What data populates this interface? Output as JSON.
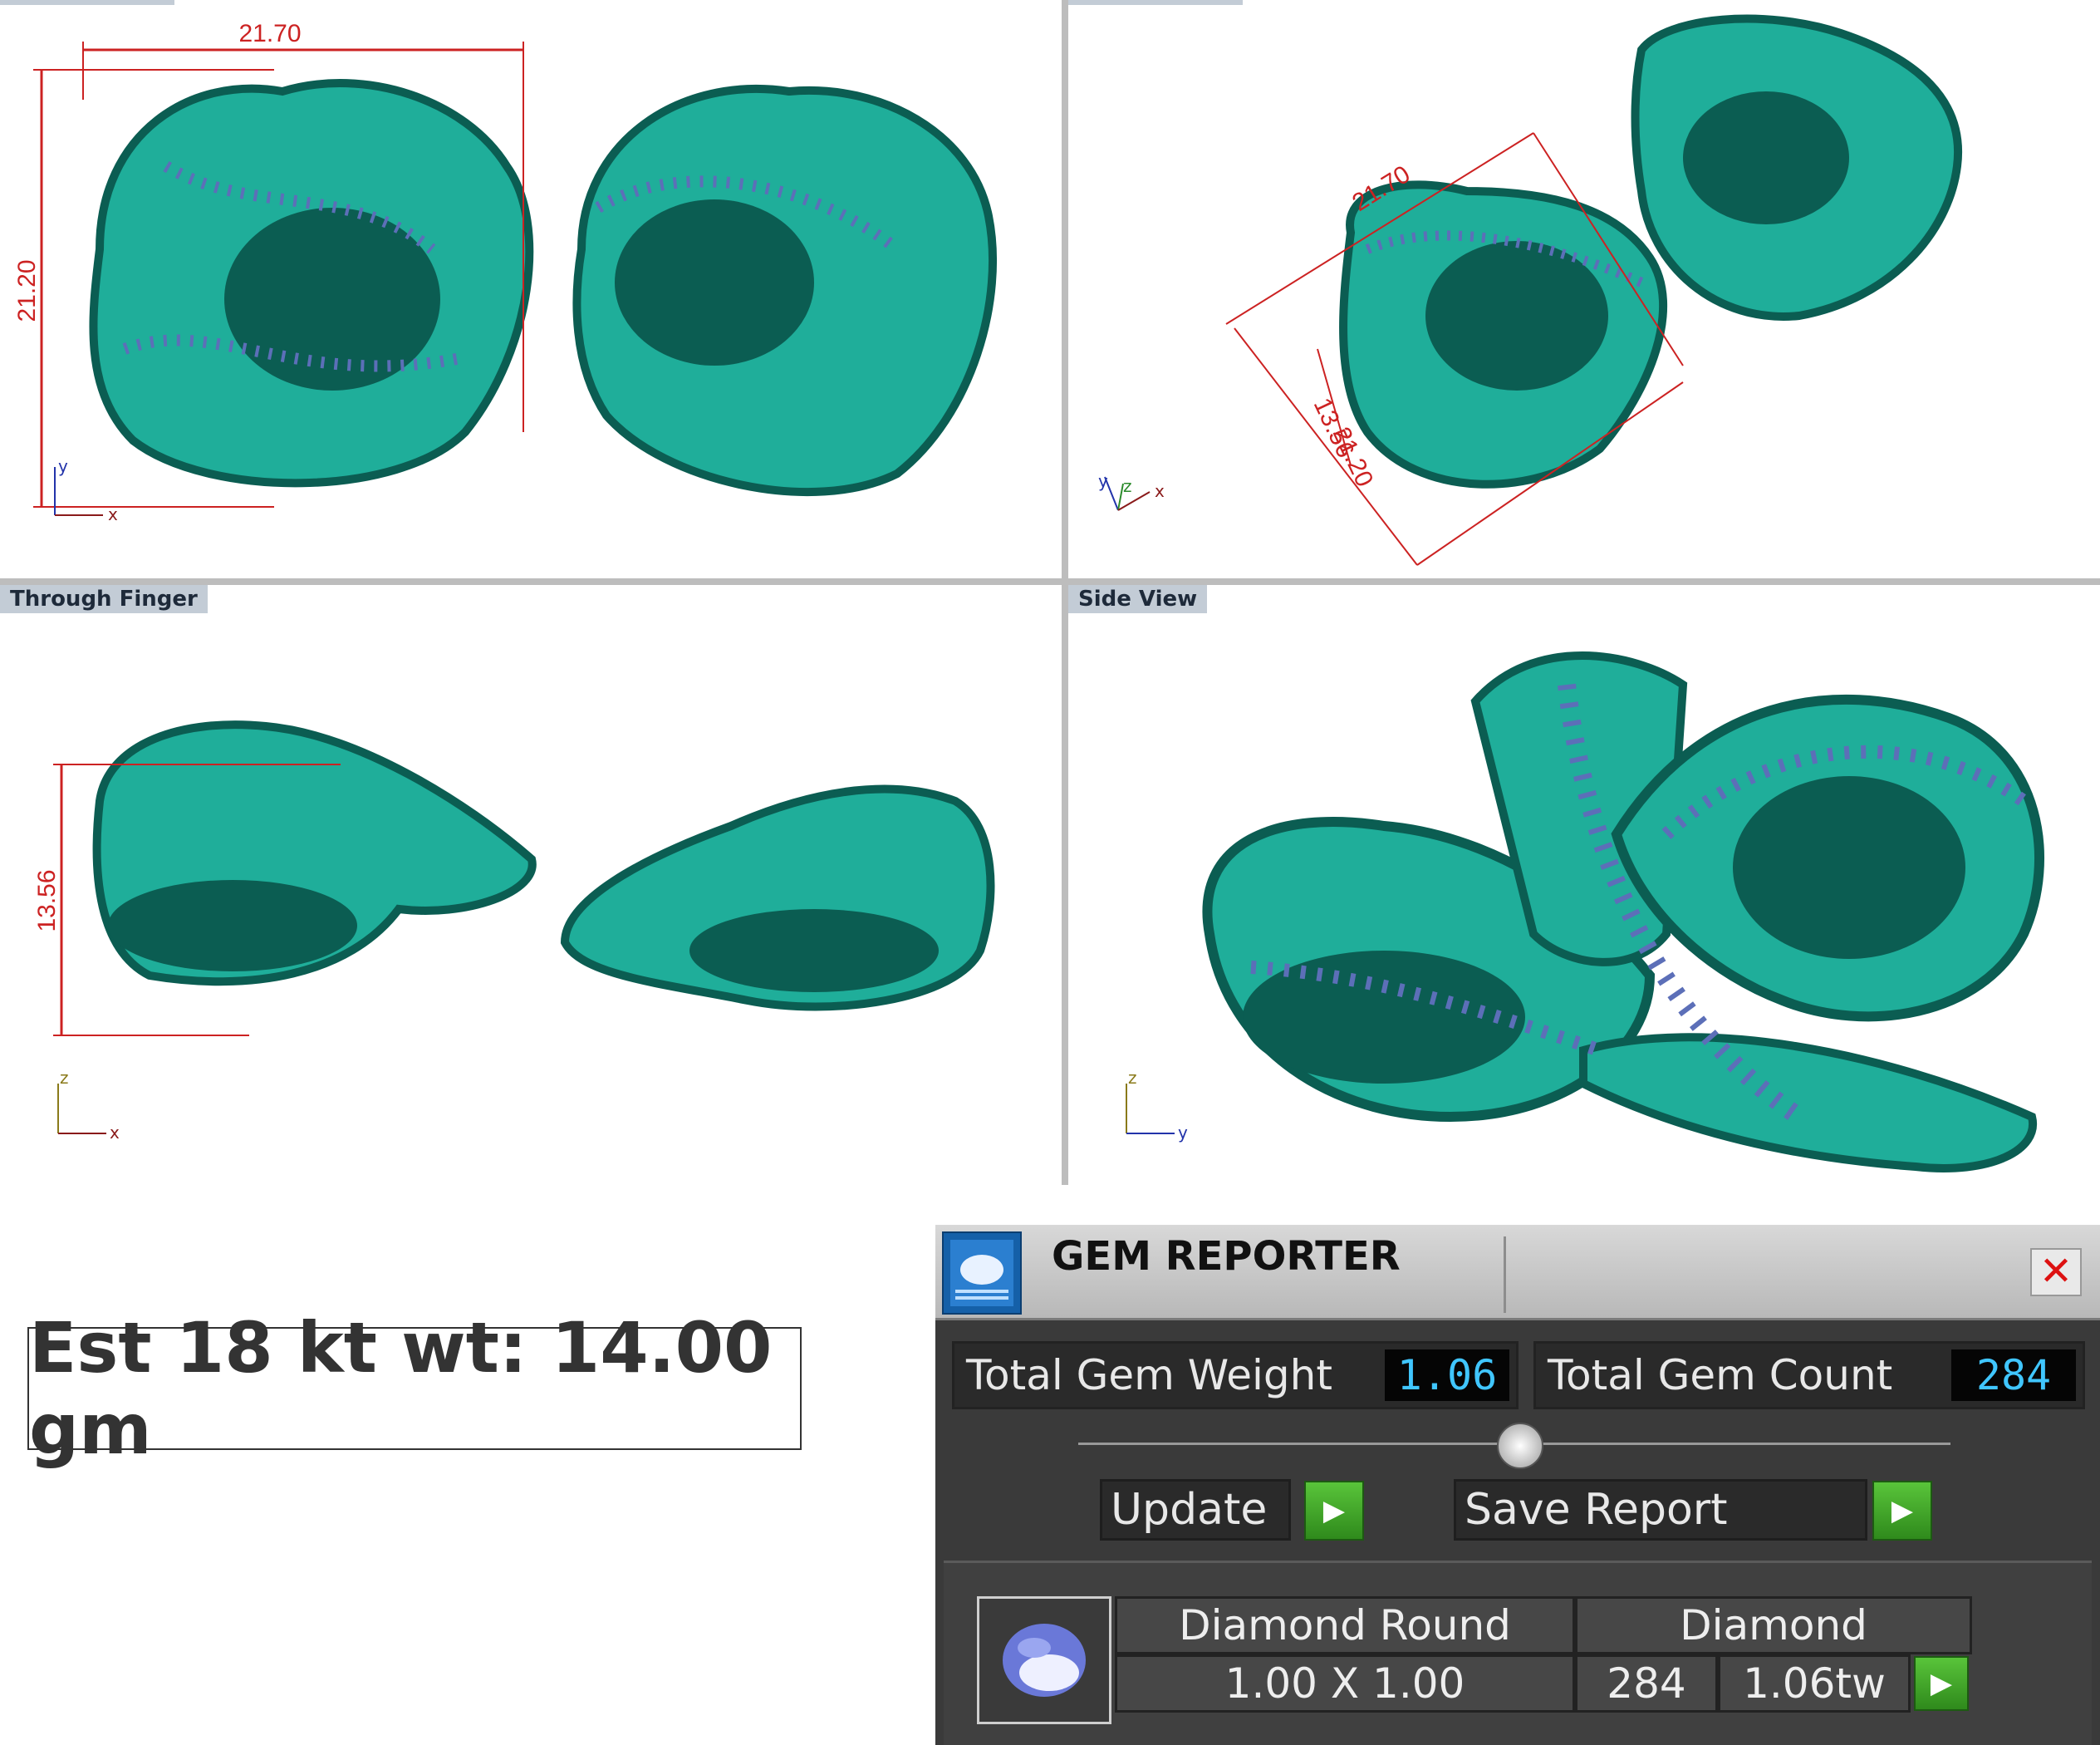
{
  "viewports": {
    "top_left": {
      "title": "",
      "dimensions": {
        "width": "21.70",
        "height": "21.20"
      },
      "axes": {
        "a": "y",
        "b": "x"
      }
    },
    "top_right": {
      "title": "",
      "dimensions": {
        "diag_1": "21.70",
        "diag_2": "13.56",
        "diag_3": "21.20"
      },
      "axes": {
        "a": "y",
        "b": "z",
        "c": "x"
      }
    },
    "bottom_left": {
      "title": "Through Finger",
      "dimensions": {
        "height": "13.56"
      },
      "axes": {
        "a": "z",
        "b": "x"
      }
    },
    "bottom_right": {
      "title": "Side View",
      "axes": {
        "a": "z",
        "b": "y"
      }
    }
  },
  "metal_weight": {
    "text": "Est 18 kt wt: 14.00 gm"
  },
  "gem_reporter": {
    "title": "GEM REPORTER",
    "close_icon": "close-icon",
    "total_gem_weight_label": "Total Gem Weight",
    "total_gem_weight": "1.06",
    "total_gem_count_label": "Total Gem Count",
    "total_gem_count": "284",
    "update_label": "Update",
    "save_report_label": "Save Report",
    "gems": [
      {
        "shape": "Diamond Round",
        "material": "Diamond",
        "size": "1.00 X 1.00",
        "count": "284",
        "weight": "1.06tw"
      }
    ]
  },
  "colors": {
    "model": "#1fae9a",
    "model_dark": "#0b5d52",
    "gem": "#5c6fb8",
    "dimension": "#cc2222",
    "value_text": "#40c6ff"
  }
}
